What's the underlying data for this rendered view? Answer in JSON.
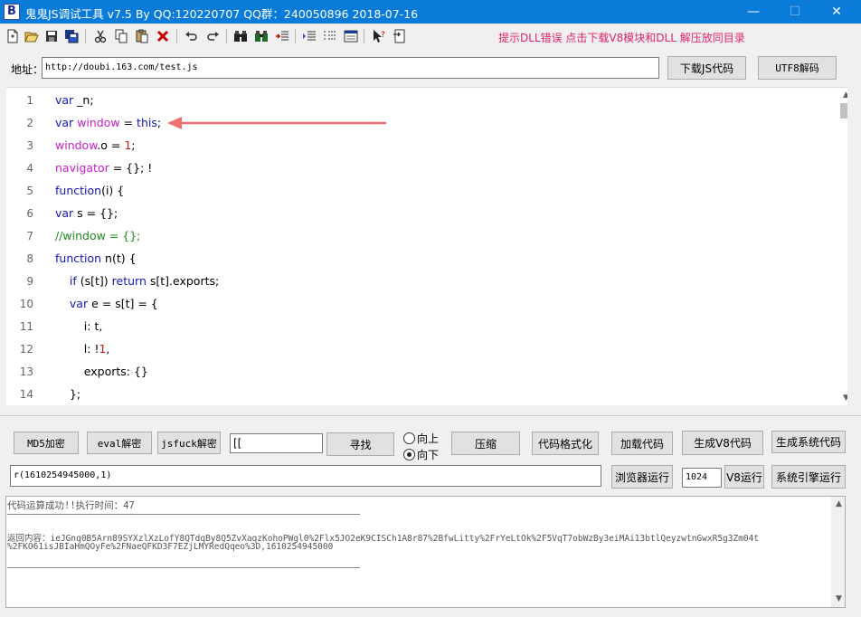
{
  "window": {
    "title": "鬼鬼JS调试工具 v7.5 By QQ:120220707  QQ群：240050896  2018-07-16",
    "icon_letter": "B",
    "minimize": "—",
    "maximize": "☐",
    "close": "✕"
  },
  "toolbar": {
    "icons": [
      "new-file",
      "open-folder",
      "save",
      "save-all",
      "cut",
      "copy",
      "paste",
      "delete",
      "undo",
      "redo",
      "find",
      "find-next",
      "replace",
      "indent",
      "format-list",
      "window",
      "help-pointer",
      "export"
    ],
    "hint": "提示DLL错误  点击下载V8模块和DLL  解压放同目录"
  },
  "address": {
    "label": "地址：",
    "value": "http://doubi.163.com/test.js",
    "download_button": "下载JS代码",
    "utf8_button": "UTF8解码"
  },
  "editor": {
    "lines": [
      {
        "n": "1",
        "html": "<span class=\"kw\">var</span> _n;"
      },
      {
        "n": "2",
        "html": "<span class=\"kw\">var</span> <span class=\"gl\">window</span> = <span class=\"kw\">this</span>;"
      },
      {
        "n": "3",
        "html": "<span class=\"gl\">window</span>.o = <span class=\"num\">1</span>;"
      },
      {
        "n": "4",
        "html": "<span class=\"gl\">navigator</span> = {}; !"
      },
      {
        "n": "5",
        "html": "<span class=\"kw\">function</span>(i) {"
      },
      {
        "n": "6",
        "html": "<span class=\"kw\">var</span> s = {};"
      },
      {
        "n": "7",
        "html": "<span class=\"cm\">//window = {};</span>"
      },
      {
        "n": "8",
        "html": "<span class=\"kw\">function</span> n(t) {"
      },
      {
        "n": "9",
        "html": "    <span class=\"kw\">if</span> (s[t]) <span class=\"kw\">return</span> s[t].exports;"
      },
      {
        "n": "10",
        "html": "    <span class=\"kw\">var</span> e = s[t] = {"
      },
      {
        "n": "11",
        "html": "        i: t,"
      },
      {
        "n": "12",
        "html": "        l: !<span class=\"num\">1</span>,"
      },
      {
        "n": "13",
        "html": "        exports: {}"
      },
      {
        "n": "14",
        "html": "    };"
      }
    ],
    "arrow_color": "#f07070"
  },
  "controls": {
    "md5_button": "MD5加密",
    "eval_button": "eval解密",
    "jsfuck_button": "jsfuck解密",
    "search_value": "[[",
    "find_button": "寻找",
    "radio_up": "向上",
    "radio_down": "向下",
    "compress_button": "压缩",
    "format_button": "代码格式化",
    "load_button": "加载代码",
    "gen_v8_button": "生成V8代码",
    "gen_sys_button": "生成系统代码",
    "command_value": "r(1610254945000,1)",
    "browser_run_button": "浏览器运行",
    "v8_number": "1024",
    "v8_run_button": "V8运行",
    "sys_engine_button": "系统引擎运行"
  },
  "output": {
    "status": "代码运算成功!!执行时间：47",
    "result_line1": "返回内容：ieJGnq0B5Arn89SYXzlXzLofY8QTdqBy8Q5ZvXaqzKohoPWgl0%2Flx5JO2eK9CISCh1A8r87%2BfwLitty%2FrYeLtOk%2F5VqT7obWzBy3eiMAi13btlQeyzwtnGwxR5g3Zm04t",
    "result_line2": "%2FKO61isJBIaHmQOyFe%2FNaeQFKD3F7EZjLMYRedQqeo%3D,1610254945000"
  },
  "colors": {
    "titlebar": "#0a7bd9",
    "hint": "#e0246e",
    "keyword": "#1515b8",
    "global": "#c81fc8",
    "number": "#c81818",
    "comment": "#1f8a1f"
  }
}
